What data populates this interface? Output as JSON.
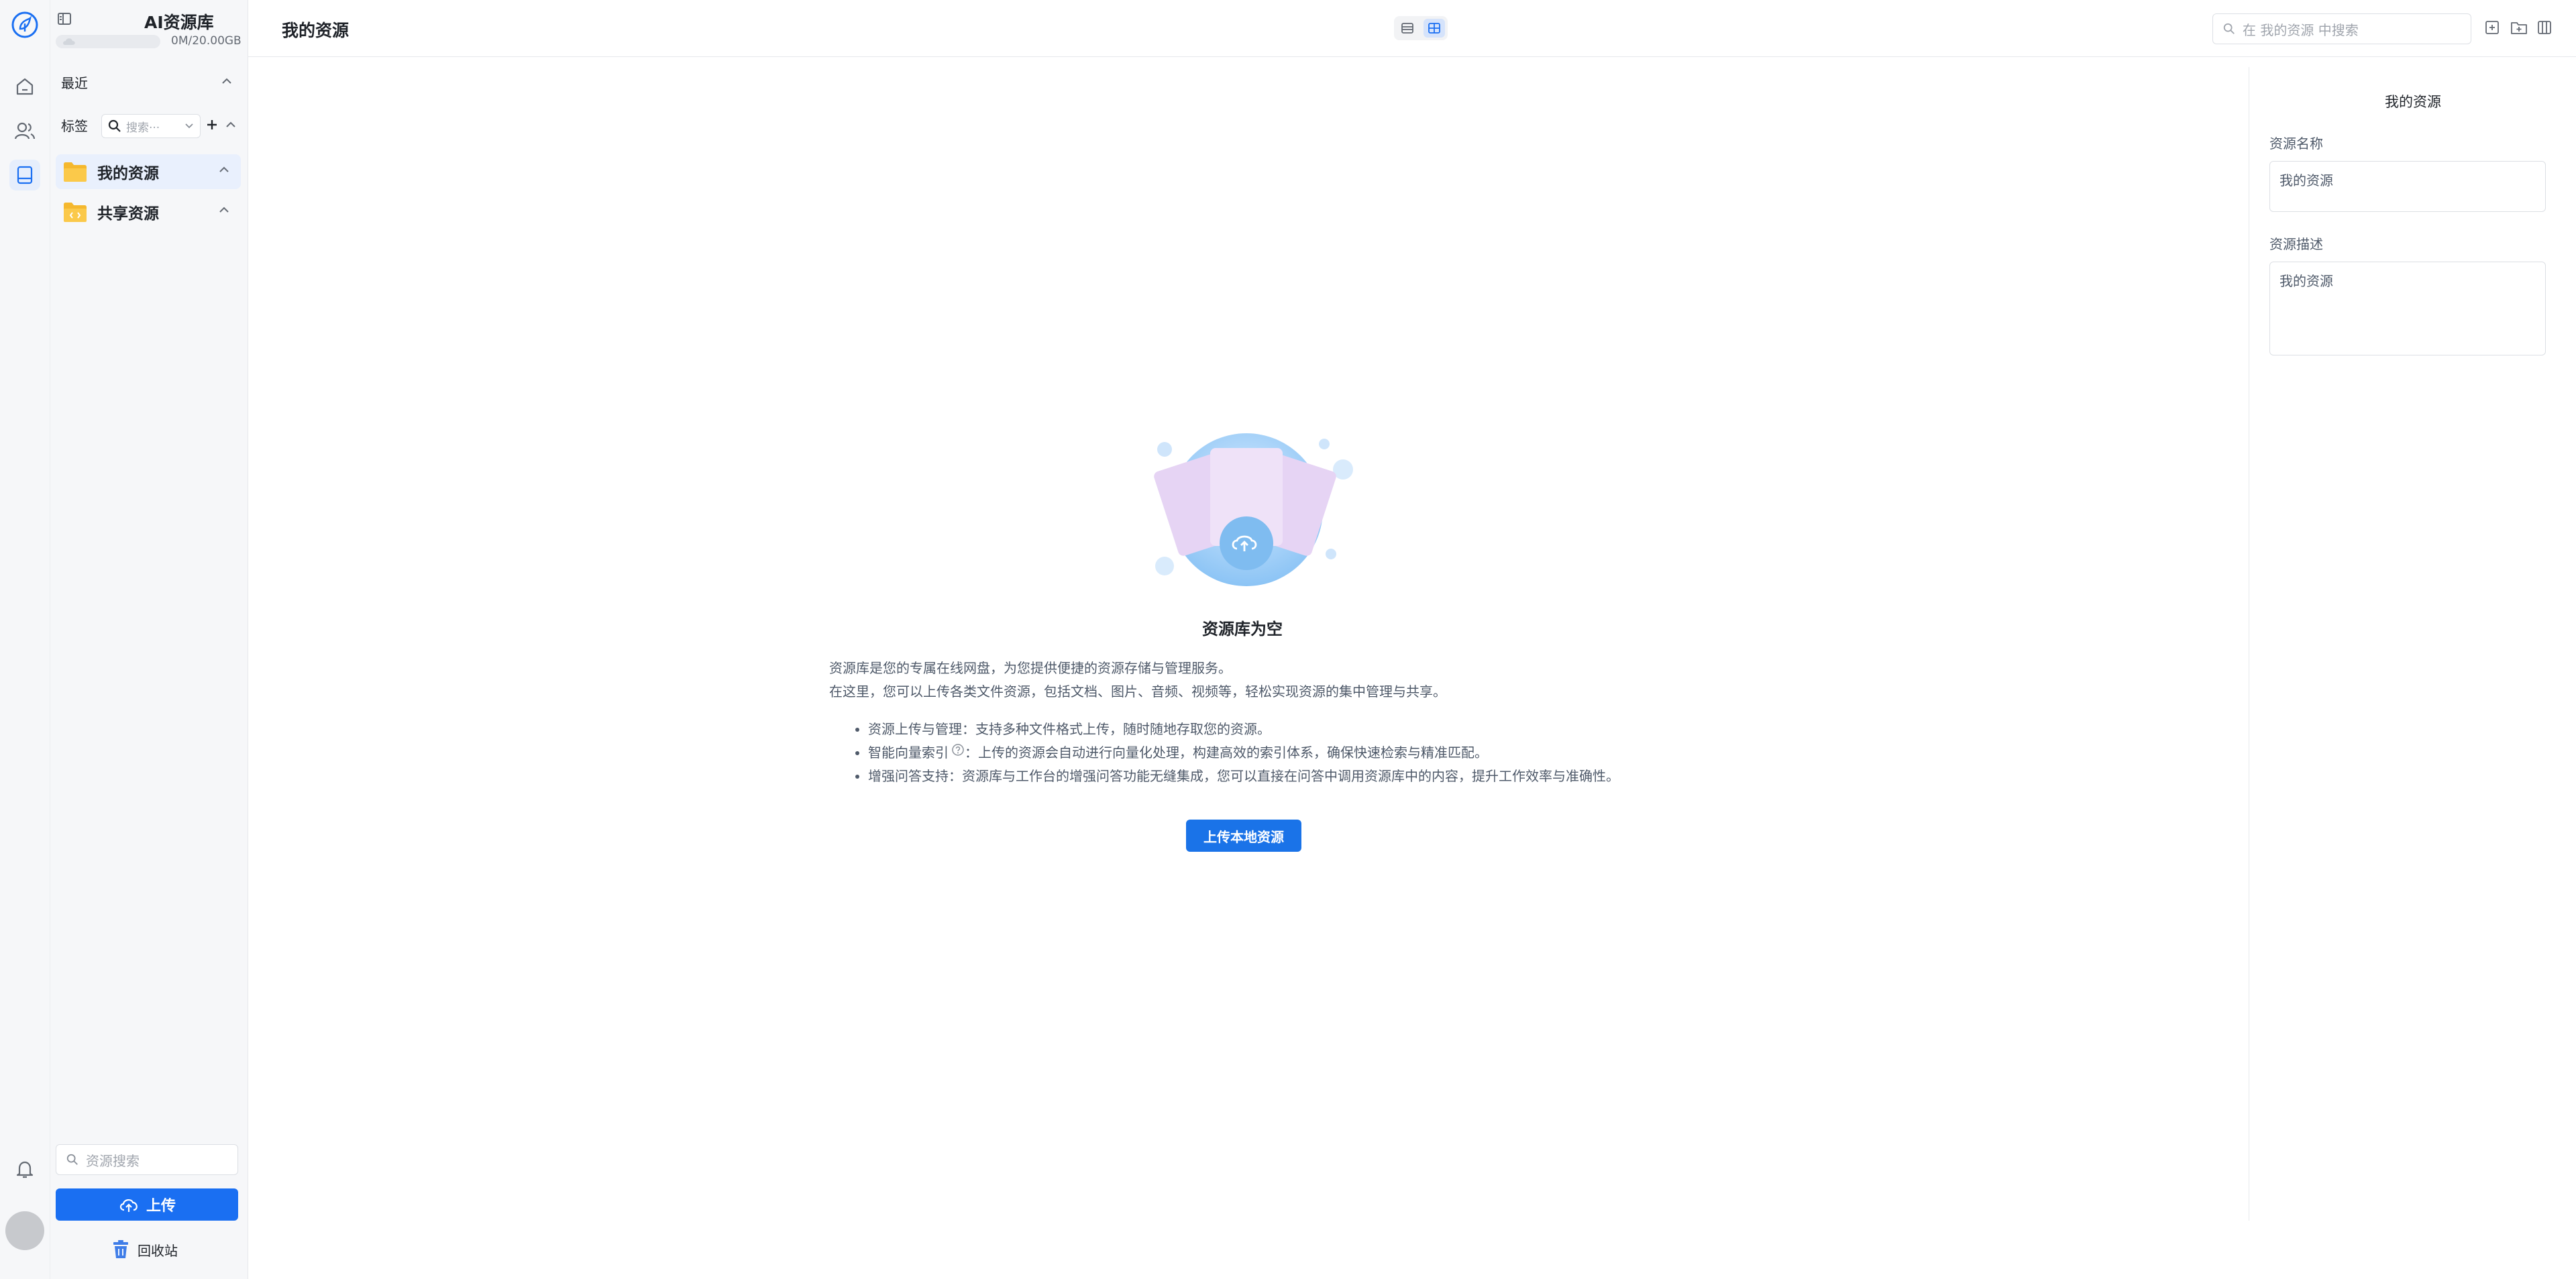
{
  "sidebar": {
    "app_title": "AI资源库",
    "storage": "0M/20.00GB",
    "recent_label": "最近",
    "tags_label": "标签",
    "tag_search_placeholder": "搜索···",
    "tree": [
      {
        "label": "我的资源",
        "active": true
      },
      {
        "label": "共享资源",
        "active": false
      }
    ],
    "search_placeholder": "资源搜索",
    "upload_label": "上传",
    "trash_label": "回收站"
  },
  "header": {
    "title": "我的资源",
    "view_mode": "grid",
    "search_placeholder": "在 我的资源 中搜索"
  },
  "empty_state": {
    "title": "资源库为空",
    "intro": [
      "资源库是您的专属在线网盘，为您提供便捷的资源存储与管理服务。",
      "在这里，您可以上传各类文件资源，包括文档、图片、音频、视频等，轻松实现资源的集中管理与共享。"
    ],
    "features": [
      {
        "name": "资源上传与管理",
        "text": "：支持多种文件格式上传，随时随地存取您的资源。"
      },
      {
        "name": "智能向量索引",
        "text": "：上传的资源会自动进行向量化处理，构建高效的索引体系，确保快速检索与精准匹配。"
      },
      {
        "name": "增强问答支持",
        "text": "：资源库与工作台的增强问答功能无缝集成，您可以直接在问答中调用资源库中的内容，提升工作效率与准确性。"
      }
    ],
    "cta_label": "上传本地资源"
  },
  "panel": {
    "title": "我的资源",
    "name_label": "资源名称",
    "name_value": "我的资源",
    "desc_label": "资源描述",
    "desc_value": "我的资源"
  },
  "colors": {
    "accent": "#1a6ff2",
    "folder": "#f5b82e",
    "active_bg": "#e9f0fd"
  },
  "icons": {
    "rail": [
      "logo-icon",
      "home-icon",
      "users-icon",
      "library-icon",
      "bell-icon"
    ],
    "header_actions": [
      "new-file-icon",
      "new-folder-icon",
      "panel-toggle-icon"
    ]
  }
}
